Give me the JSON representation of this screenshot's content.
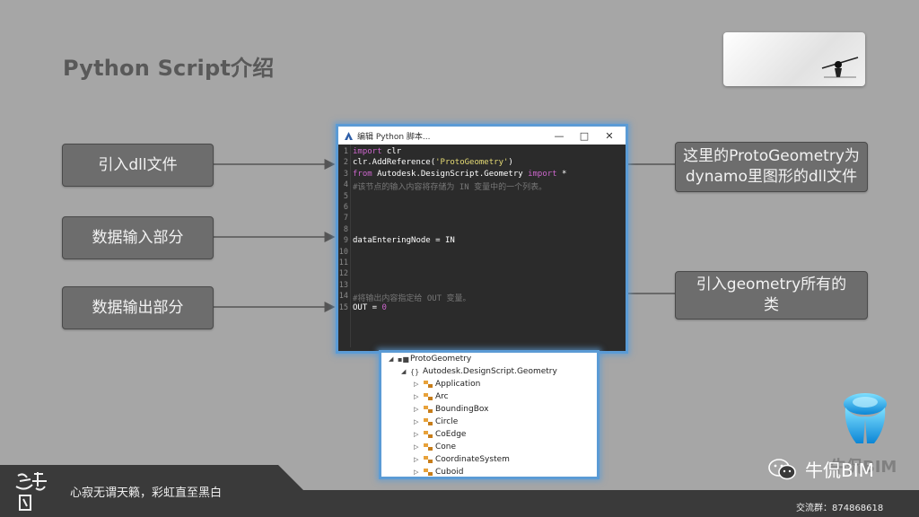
{
  "slide": {
    "title": "Python Script介绍"
  },
  "labels": {
    "import_dll": "引入dll文件",
    "data_input": "数据输入部分",
    "data_output": "数据输出部分",
    "protogeometry_line1": "这里的ProtoGeometry为",
    "protogeometry_line2": "dynamo里图形的dll文件",
    "geometry_classes_line1": "引入geometry所有的",
    "geometry_classes_line2": "类"
  },
  "editor": {
    "window_title": "编辑 Python 脚本...",
    "lines": [
      {
        "n": "1",
        "tokens": [
          {
            "t": "import",
            "c": "kw"
          },
          {
            "t": " clr",
            "c": ""
          }
        ]
      },
      {
        "n": "2",
        "tokens": [
          {
            "t": "clr.AddReference(",
            "c": ""
          },
          {
            "t": "'ProtoGeometry'",
            "c": "str"
          },
          {
            "t": ")",
            "c": ""
          }
        ]
      },
      {
        "n": "3",
        "tokens": [
          {
            "t": "from",
            "c": "kw"
          },
          {
            "t": " Autodesk.DesignScript.Geometry ",
            "c": ""
          },
          {
            "t": "import",
            "c": "kw"
          },
          {
            "t": " *",
            "c": ""
          }
        ]
      },
      {
        "n": "4",
        "tokens": [
          {
            "t": "#该节点的输入内容将存储为 IN 变量中的一个列表。",
            "c": "cm"
          }
        ]
      },
      {
        "n": "5",
        "tokens": []
      },
      {
        "n": "6",
        "tokens": []
      },
      {
        "n": "7",
        "tokens": []
      },
      {
        "n": "8",
        "tokens": []
      },
      {
        "n": "9",
        "tokens": [
          {
            "t": "dataEnteringNode = IN",
            "c": ""
          }
        ]
      },
      {
        "n": "10",
        "tokens": []
      },
      {
        "n": "11",
        "tokens": []
      },
      {
        "n": "12",
        "tokens": []
      },
      {
        "n": "13",
        "tokens": []
      },
      {
        "n": "14",
        "tokens": [
          {
            "t": "#将输出内容指定给 OUT 变量。",
            "c": "cm"
          }
        ]
      },
      {
        "n": "15",
        "tokens": [
          {
            "t": "OUT = ",
            "c": ""
          },
          {
            "t": "0",
            "c": "num"
          }
        ]
      }
    ]
  },
  "tree": {
    "root": "ProtoGeometry",
    "namespace": "Autodesk.DesignScript.Geometry",
    "classes": [
      "Application",
      "Arc",
      "BoundingBox",
      "Circle",
      "CoEdge",
      "Cone",
      "CoordinateSystem",
      "Cuboid"
    ]
  },
  "footer": {
    "seal_text": "点星阁",
    "motto": "心寂无谓天籁，彩虹直至黑白",
    "wechat_name": "牛侃BIM",
    "group_label": "交流群：874868618",
    "brand_watermark": "牛侃BIM"
  },
  "colors": {
    "background": "#a6a6a6",
    "label_box": "#6d6d6d",
    "editor_bg": "#2b2b2b",
    "highlight_border": "#5b9bd5",
    "keyword": "#cc66cc",
    "string": "#e6db74",
    "comment": "#777777",
    "footer": "#3a3a3a"
  },
  "icons": {
    "dynamo": "dynamo-logo-icon",
    "minimize": "minimize-icon",
    "maximize": "maximize-icon",
    "close": "close-icon",
    "wechat": "wechat-icon"
  }
}
